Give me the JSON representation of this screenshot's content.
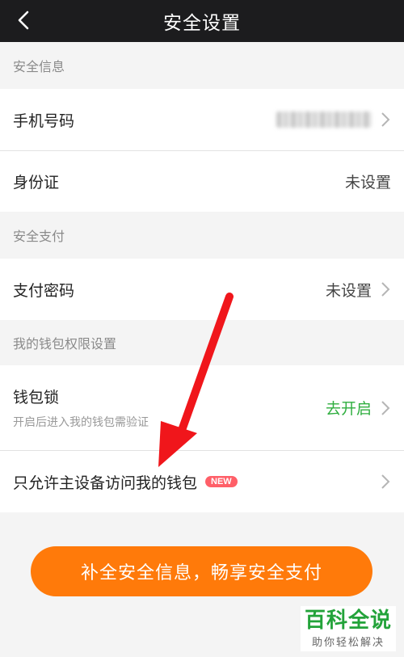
{
  "header": {
    "title": "安全设置",
    "back_icon": "chevron-left-icon"
  },
  "sections": {
    "security_info": "安全信息",
    "secure_payment": "安全支付",
    "wallet_permissions": "我的钱包权限设置"
  },
  "rows": {
    "phone": {
      "label": "手机号码",
      "value_masked": true
    },
    "id_card": {
      "label": "身份证",
      "value": "未设置"
    },
    "pay_password": {
      "label": "支付密码",
      "value": "未设置"
    },
    "wallet_lock": {
      "label": "钱包锁",
      "sub": "开启后进入我的钱包需验证",
      "value": "去开启"
    },
    "main_device": {
      "label": "只允许主设备访问我的钱包",
      "badge": "NEW"
    }
  },
  "cta": {
    "label": "补全安全信息，畅享安全支付"
  },
  "watermark": {
    "title": "百科全说",
    "subtitle": "助你轻松解决"
  },
  "colors": {
    "accent": "#ff7a0a",
    "green": "#2fae3f",
    "badge": "#ff5f68",
    "arrow": "#f0161b"
  }
}
